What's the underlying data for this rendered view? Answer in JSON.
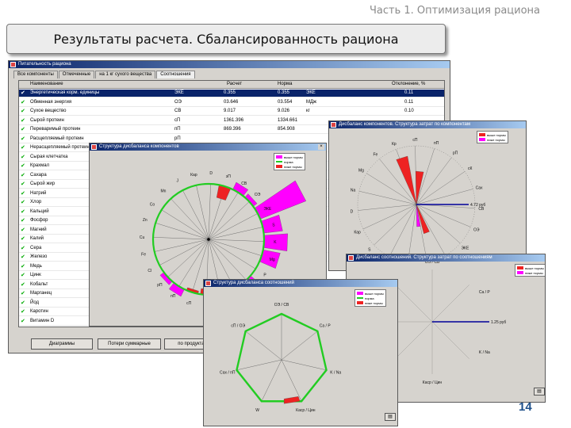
{
  "slide": {
    "header": "Часть 1. Оптимизация рациона",
    "title": "Результаты расчета. Сбалансированность рациона",
    "page_number": "14"
  },
  "main_window": {
    "title": "Питательность рациона",
    "tabs": [
      "Все компоненты",
      "Отмеченные",
      "на 1 кг сухого вещества",
      "Соотношения"
    ],
    "columns": [
      "Наименование",
      "Расчет",
      "Норма",
      "Отклонение, %"
    ],
    "rows": [
      {
        "name": "Энергетическая корм. единицы",
        "unit": "ЭКЕ",
        "calc": "0.355",
        "norm": "0.355",
        "unit2": "ЭКЕ",
        "dev": "0.11"
      },
      {
        "name": "Обменная энергия",
        "unit": "ОЭ",
        "calc": "03.646",
        "norm": "03.554",
        "unit2": "МДж",
        "dev": "0.11"
      },
      {
        "name": "Сухое вещество",
        "unit": "СВ",
        "calc": "9.017",
        "norm": "9.026",
        "unit2": "кг",
        "dev": "0.10"
      },
      {
        "name": "Сырой протеин",
        "unit": "сП",
        "calc": "1361.396",
        "norm": "1334.661",
        "unit2": "",
        "dev": ""
      },
      {
        "name": "Переваримый протеин",
        "unit": "пП",
        "calc": "869.396",
        "norm": "854.908",
        "unit2": "",
        "dev": ""
      },
      {
        "name": "Расщепляемый протеин",
        "unit": "рП",
        "calc": "",
        "norm": "",
        "unit2": "",
        "dev": ""
      },
      {
        "name": "Нерасщепляемый протеин",
        "unit": "",
        "calc": "",
        "norm": "",
        "unit2": "",
        "dev": ""
      },
      {
        "name": "Сырая клетчатка",
        "unit": "",
        "calc": "",
        "norm": "",
        "unit2": "",
        "dev": ""
      },
      {
        "name": "Крахмал",
        "unit": "",
        "calc": "",
        "norm": "",
        "unit2": "",
        "dev": ""
      },
      {
        "name": "Сахара",
        "unit": "",
        "calc": "",
        "norm": "",
        "unit2": "",
        "dev": ""
      },
      {
        "name": "Сырой жир",
        "unit": "",
        "calc": "",
        "norm": "",
        "unit2": "",
        "dev": ""
      },
      {
        "name": "Натрий",
        "unit": "",
        "calc": "",
        "norm": "",
        "unit2": "",
        "dev": ""
      },
      {
        "name": "Хлор",
        "unit": "",
        "calc": "",
        "norm": "",
        "unit2": "",
        "dev": ""
      },
      {
        "name": "Кальций",
        "unit": "",
        "calc": "",
        "norm": "",
        "unit2": "",
        "dev": ""
      },
      {
        "name": "Фосфор",
        "unit": "",
        "calc": "",
        "norm": "",
        "unit2": "",
        "dev": ""
      },
      {
        "name": "Магний",
        "unit": "",
        "calc": "",
        "norm": "",
        "unit2": "",
        "dev": ""
      },
      {
        "name": "Калий",
        "unit": "",
        "calc": "",
        "norm": "",
        "unit2": "",
        "dev": ""
      },
      {
        "name": "Сера",
        "unit": "",
        "calc": "",
        "norm": "",
        "unit2": "",
        "dev": ""
      },
      {
        "name": "Железо",
        "unit": "",
        "calc": "",
        "norm": "",
        "unit2": "",
        "dev": ""
      },
      {
        "name": "Медь",
        "unit": "",
        "calc": "",
        "norm": "",
        "unit2": "",
        "dev": ""
      },
      {
        "name": "Цинк",
        "unit": "",
        "calc": "",
        "norm": "",
        "unit2": "",
        "dev": ""
      },
      {
        "name": "Кобальт",
        "unit": "",
        "calc": "",
        "norm": "",
        "unit2": "",
        "dev": ""
      },
      {
        "name": "Марганец",
        "unit": "",
        "calc": "",
        "norm": "",
        "unit2": "",
        "dev": ""
      },
      {
        "name": "Йод",
        "unit": "",
        "calc": "",
        "norm": "",
        "unit2": "",
        "dev": ""
      },
      {
        "name": "Каротин",
        "unit": "",
        "calc": "",
        "norm": "",
        "unit2": "",
        "dev": ""
      },
      {
        "name": "Витамин D",
        "unit": "D",
        "calc": "",
        "norm": "",
        "unit2": "",
        "dev": ""
      }
    ],
    "buttons": [
      "Диаграммы",
      "Потери суммарные",
      "по продуктам"
    ]
  },
  "chart_windows": [
    {
      "title": "Структура дисбаланса компонентов",
      "legend": [
        "выше нормы",
        "норма",
        "ниже нормы"
      ],
      "axes": [
        "эП",
        "СВ",
        "ОЭ",
        "ЭКЕ",
        "S",
        "K",
        "Mg",
        "P",
        "Ca",
        "Na",
        "Сах",
        "Кр",
        "сП",
        "пП",
        "рП",
        "Cl",
        "Fe",
        "Cu",
        "Zn",
        "Co",
        "Mn",
        "J",
        "Кар",
        "D"
      ]
    },
    {
      "title": "Дисбаланс компонентов. Структура затрат по компонентам",
      "legend": [
        "выше нормы",
        "ниже нормы"
      ],
      "axes": [
        "Кр",
        "сП",
        "пП",
        "рП",
        "сК",
        "Сах",
        "СВ",
        "ОЭ",
        "ЭКЕ",
        "Cl",
        "Са",
        "P",
        "K",
        "S",
        "Кар",
        "D",
        "Na",
        "Mg",
        "Fe"
      ],
      "annotation": "4.72 руб"
    },
    {
      "title": "Дисбаланс соотношений. Структура затрат по соотношениям",
      "legend": [
        "выше нормы",
        "ниже нормы"
      ],
      "axes": [
        "ОЭ / СВ",
        "Ca / P",
        "K / Na",
        "Каср / Цин"
      ],
      "annotation": "1.25 руб"
    },
    {
      "title": "Структура дисбаланса соотношений",
      "legend": [
        "выше нормы",
        "норма",
        "ниже нормы"
      ],
      "axes": [
        "ОЭ / СВ",
        "Ca / P",
        "K / Na",
        "Каср / Цин",
        "W",
        "Сах / пП",
        "сП / ОЭ"
      ]
    }
  ],
  "colors": {
    "above": "#ff00ff",
    "norm": "#22cc22",
    "below": "#ee2222",
    "cost": "#000099"
  }
}
